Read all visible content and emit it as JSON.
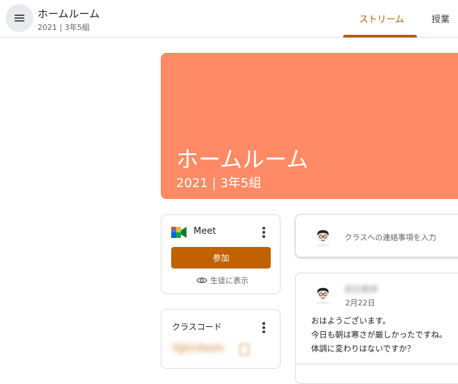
{
  "header": {
    "class_name": "ホームルーム",
    "class_section": "2021 | 3年5組",
    "tabs": [
      {
        "label": "ストリーム",
        "active": true
      },
      {
        "label": "授業",
        "active": false
      }
    ],
    "accent_color": "#b06000"
  },
  "banner": {
    "title": "ホームルーム",
    "subtitle": "2021 | 3年5組",
    "color": "#ff8a65"
  },
  "meet": {
    "label": "Meet",
    "join_label": "参加",
    "visibility_label": "生徒に表示"
  },
  "class_code": {
    "label": "クラスコード",
    "value": "fgtx4wm"
  },
  "announce": {
    "placeholder": "クラスへの連絡事項を入力"
  },
  "post": {
    "author": "担任教師",
    "date": "2月22日",
    "lines": [
      "おはようございます。",
      "今日も朝は寒さが厳しかったですね。",
      "体調に変わりはないですか？"
    ]
  },
  "icons": {
    "menu": "menu-icon",
    "meet": "google-meet-icon",
    "more": "more-vert-icon",
    "eye": "eye-icon",
    "copy": "copy-icon",
    "avatar": "user-avatar-icon"
  }
}
